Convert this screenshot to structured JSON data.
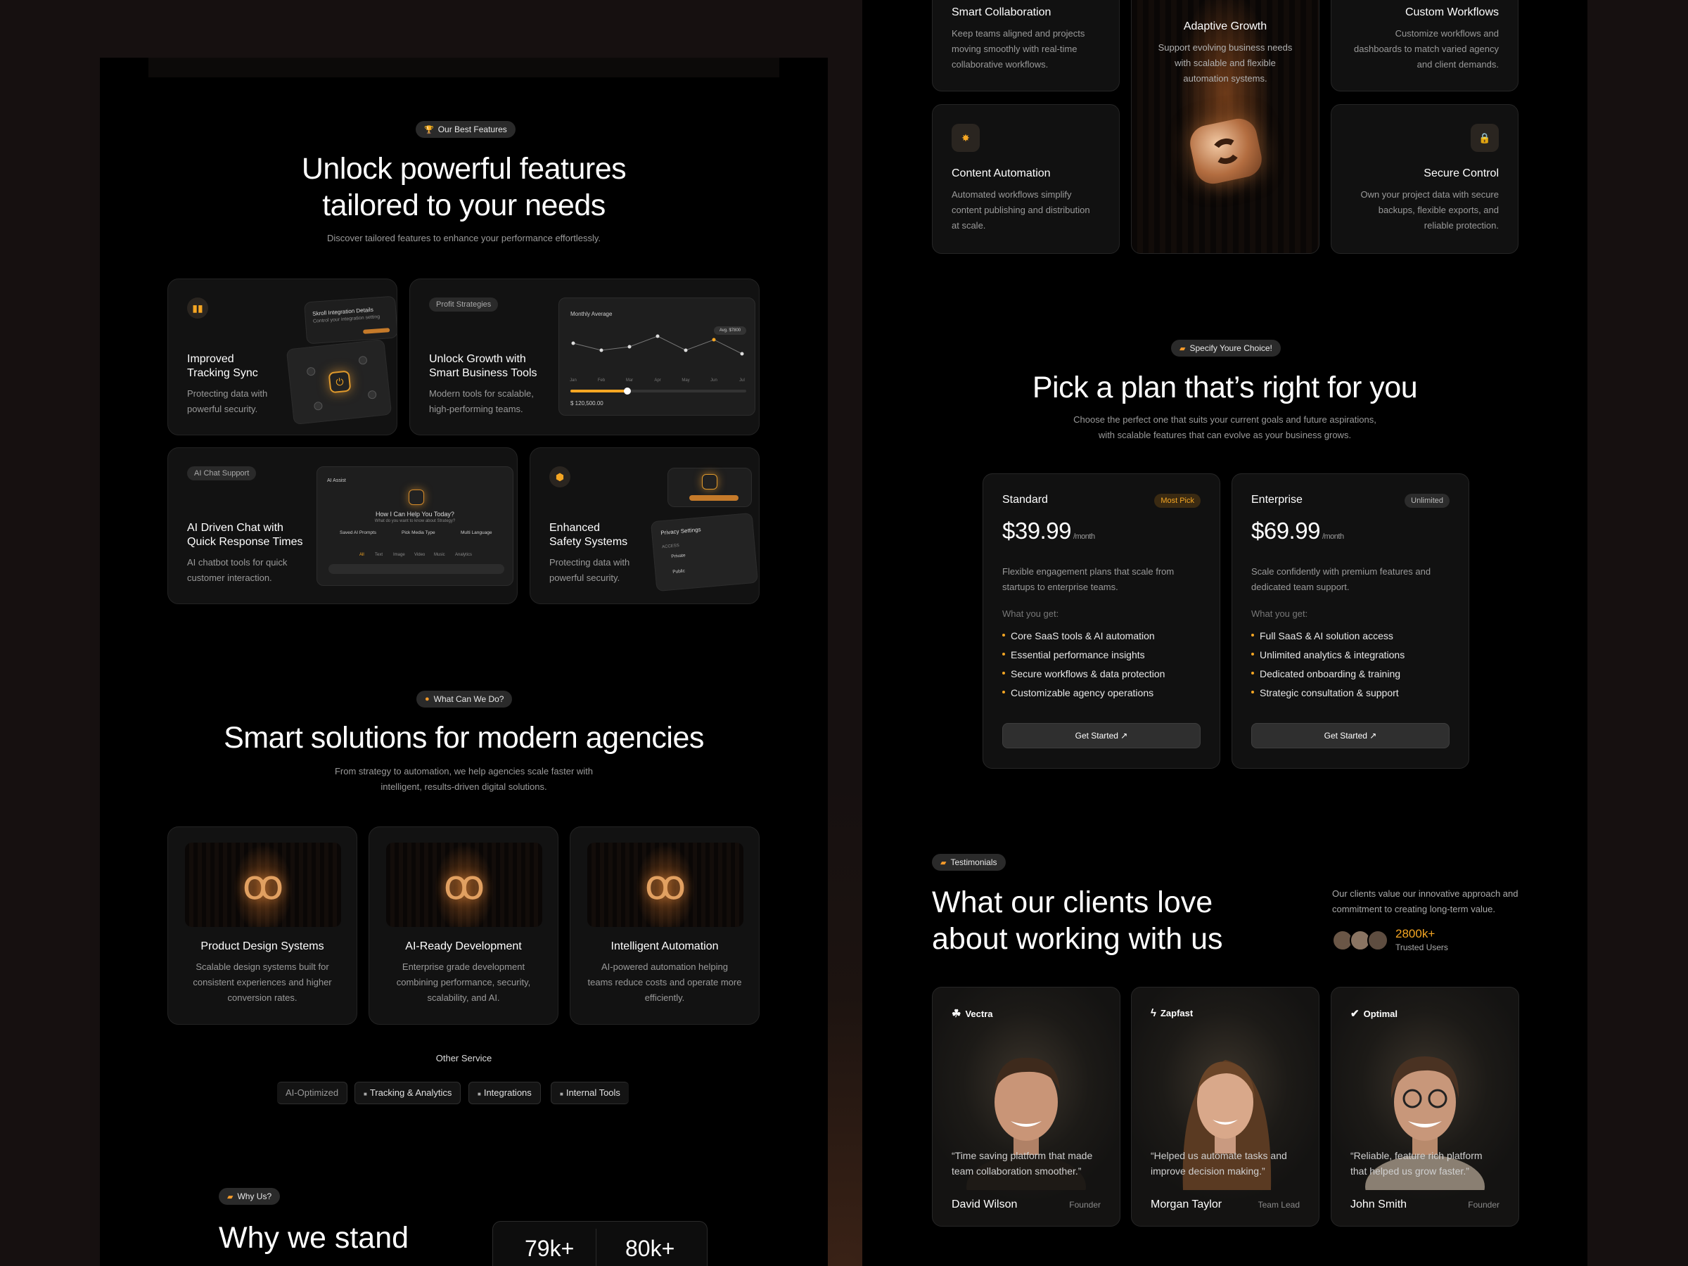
{
  "features": {
    "badge": "Our Best Features",
    "title_line1": "Unlock powerful features",
    "title_line2": "tailored to your needs",
    "subtitle": "Discover tailored features to enhance your performance effortlessly.",
    "card1": {
      "title_l1": "Improved",
      "title_l2": "Tracking Sync",
      "desc_l1": "Protecting data with",
      "desc_l2": "powerful security.",
      "mock_title": "Skroll Integration Details",
      "mock_sub": "Control your integration setting"
    },
    "card2": {
      "tag": "Profit Strategies",
      "title_l1": "Unlock Growth with",
      "title_l2": "Smart Business Tools",
      "desc_l1": "Modern tools for scalable,",
      "desc_l2": "high-performing teams.",
      "chart_title": "Monthly Average",
      "chart_months": [
        "Jan",
        "Feb",
        "Mar",
        "Apr",
        "May",
        "Jun",
        "Jul"
      ],
      "chart_values": [
        4,
        3,
        3.5,
        5,
        3,
        4.5,
        2.5
      ],
      "chart_amount": "$ 120,500.00",
      "chart_badge": "Avg. $7800"
    },
    "card3": {
      "tag": "AI Chat Support",
      "title_l1": "AI Driven Chat with",
      "title_l2": "Quick Response Times",
      "desc_l1": "AI chatbot tools for quick",
      "desc_l2": "customer interaction.",
      "mock_header": "AI Assist",
      "mock_q": "How I Can Help You Today?",
      "mock_sub": "What do you want to know about Strategy?",
      "mock_opts": [
        "Saved AI Prompts",
        "Pick Media Type",
        "Multi Language"
      ],
      "mock_tabs": [
        "All",
        "Text",
        "Image",
        "Video",
        "Music",
        "Analytics"
      ]
    },
    "card4": {
      "title_l1": "Enhanced",
      "title_l2": "Safety Systems",
      "desc_l1": "Protecting data with",
      "desc_l2": "powerful security.",
      "mock_title": "Privacy Settings",
      "mock_access": "ACCESS",
      "mock_opt1": "Private",
      "mock_opt2": "Public"
    }
  },
  "solutions": {
    "badge": "What Can We Do?",
    "title": "Smart solutions for modern agencies",
    "subtitle_l1": "From strategy to automation, we help agencies scale faster with",
    "subtitle_l2": "intelligent, results-driven digital solutions.",
    "services": [
      {
        "title": "Product Design Systems",
        "d1": "Scalable design systems built for",
        "d2": "consistent experiences and higher",
        "d3": "conversion rates."
      },
      {
        "title": "AI-Ready Development",
        "d1": "Enterprise grade development",
        "d2": "combining performance, security,",
        "d3": "scalability, and AI."
      },
      {
        "title": "Intelligent Automation",
        "d1": "AI-powered automation helping",
        "d2": "teams reduce costs and operate more",
        "d3": "efficiently."
      }
    ],
    "other_label": "Other Service",
    "chips": [
      "AI-Optimized",
      "Tracking & Analytics",
      "Integrations",
      "Internal Tools"
    ]
  },
  "why": {
    "badge": "Why Us?",
    "title": "Why we stand",
    "stat1": "79k+",
    "stat2": "80k+"
  },
  "features_grid": {
    "smart": {
      "title": "Smart Collaboration",
      "d1": "Keep teams aligned and projects",
      "d2": "moving smoothly with real-time",
      "d3": "collaborative workflows."
    },
    "adaptive": {
      "title": "Adaptive Growth",
      "d1": "Support evolving business needs",
      "d2": "with scalable and flexible",
      "d3": "automation systems."
    },
    "custom": {
      "title": "Custom Workflows",
      "d1": "Customize workflows and",
      "d2": "dashboards to match varied agency",
      "d3": "and client demands."
    },
    "content": {
      "title": "Content Automation",
      "d1": "Automated workflows simplify",
      "d2": "content publishing and distribution",
      "d3": "at scale."
    },
    "secure": {
      "title": "Secure Control",
      "d1": "Own your project data with secure",
      "d2": "backups, flexible exports, and",
      "d3": "reliable protection."
    }
  },
  "pricing": {
    "badge": "Specify Youre Choice!",
    "title": "Pick a plan that’s right for you",
    "subtitle_l1": "Choose the perfect one that suits your current goals and future aspirations,",
    "subtitle_l2": "with scalable features that can evolve as your business grows.",
    "plans": [
      {
        "name": "Standard",
        "badge": "Most Pick",
        "price": "$39.99",
        "period": "/month",
        "d1": "Flexible engagement plans that scale from",
        "d2": "startups to enterprise teams.",
        "get_label": "What you get:",
        "features": [
          "Core SaaS tools & AI automation",
          "Essential performance insights",
          "Secure workflows & data protection",
          "Customizable agency operations"
        ],
        "cta": "Get Started ↗"
      },
      {
        "name": "Enterprise",
        "badge": "Unlimited",
        "price": "$69.99",
        "period": "/month",
        "d1": "Scale confidently with premium features and",
        "d2": "dedicated team support.",
        "get_label": "What you get:",
        "features": [
          "Full SaaS & AI solution access",
          "Unlimited analytics & integrations",
          "Dedicated onboarding & training",
          "Strategic consultation & support"
        ],
        "cta": "Get Started ↗"
      }
    ]
  },
  "testimonials": {
    "badge": "Testimonials",
    "title_l1": "What our clients love",
    "title_l2": "about working with us",
    "side_l1": "Our clients value our innovative approach and",
    "side_l2": "commitment to creating long-term value.",
    "count": "2800k+",
    "count_label": "Trusted Users",
    "items": [
      {
        "brand": "Vectra",
        "q1": "“Time saving platform that made",
        "q2": "team collaboration smoother.”",
        "name": "David Wilson",
        "role": "Founder"
      },
      {
        "brand": "Zapfast",
        "q1": "“Helped us automate tasks and",
        "q2": "improve decision making.”",
        "name": "Morgan Taylor",
        "role": "Team Lead"
      },
      {
        "brand": "Optimal",
        "q1": "“Reliable, feature rich platform",
        "q2": "that helped us grow faster.”",
        "name": "John Smith",
        "role": "Founder"
      }
    ]
  },
  "colors": {
    "accent": "#f5a623",
    "panel": "#000000",
    "card": "#121212"
  }
}
